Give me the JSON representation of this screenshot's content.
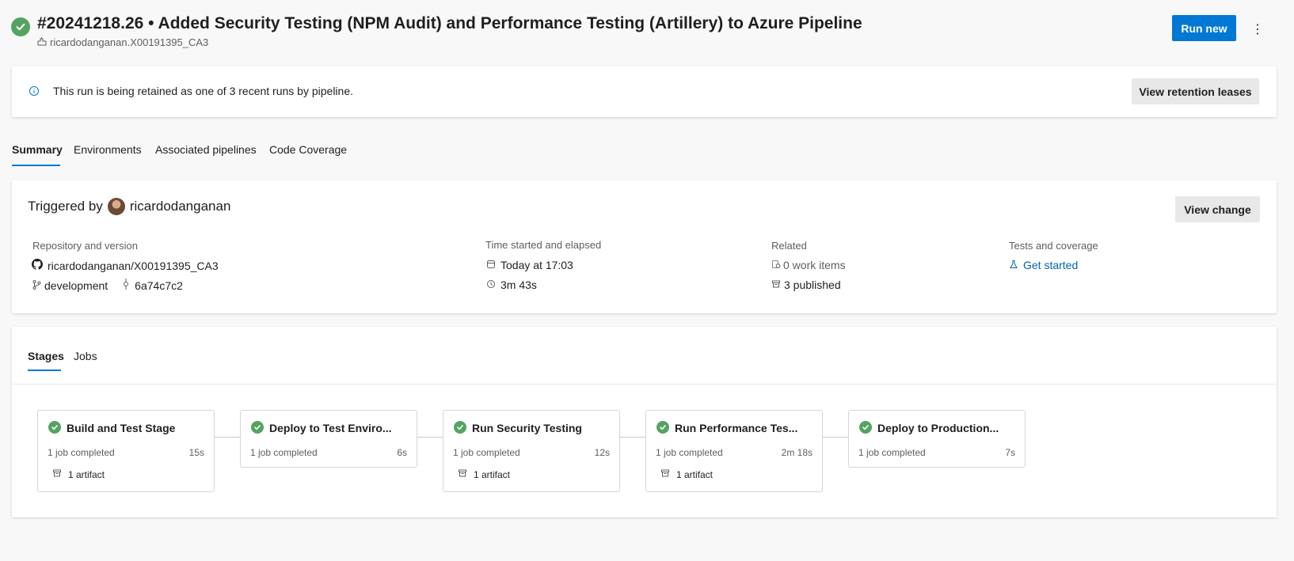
{
  "header": {
    "title": "#20241218.26 • Added Security Testing (NPM Audit) and Performance Testing (Artillery) to Azure Pipeline",
    "pipeline_name": "ricardodanganan.X00191395_CA3",
    "status_icon": "success-check-icon",
    "run_new_label": "Run new",
    "more_icon": "⋮"
  },
  "banner": {
    "text": "This run is being retained as one of 3 recent runs by pipeline.",
    "button_label": "View retention leases"
  },
  "tabs": [
    {
      "label": "Summary",
      "active": true
    },
    {
      "label": "Environments",
      "active": false
    },
    {
      "label": "Associated pipelines",
      "active": false
    },
    {
      "label": "Code Coverage",
      "active": false
    }
  ],
  "summary": {
    "triggered_prefix": "Triggered by",
    "triggered_user": "ricardodanganan",
    "view_change_label": "View change",
    "repo": {
      "label": "Repository and version",
      "repository": "ricardodanganan/X00191395_CA3",
      "branch": "development",
      "commit": "6a74c7c2"
    },
    "time": {
      "label": "Time started and elapsed",
      "started": "Today at 17:03",
      "elapsed": "3m 43s"
    },
    "related": {
      "label": "Related",
      "work_items": "0 work items",
      "published": "3 published"
    },
    "tests": {
      "label": "Tests and coverage",
      "link": "Get started"
    }
  },
  "stage_tabs": [
    {
      "label": "Stages",
      "active": true
    },
    {
      "label": "Jobs",
      "active": false
    }
  ],
  "stages": [
    {
      "name": "Build and Test Stage",
      "jobs": "1 job completed",
      "duration": "15s",
      "artifact": "1 artifact"
    },
    {
      "name": "Deploy to Test Enviro...",
      "jobs": "1 job completed",
      "duration": "6s",
      "artifact": null
    },
    {
      "name": "Run Security Testing",
      "jobs": "1 job completed",
      "duration": "12s",
      "artifact": "1 artifact"
    },
    {
      "name": "Run Performance Tes...",
      "jobs": "1 job completed",
      "duration": "2m 18s",
      "artifact": "1 artifact"
    },
    {
      "name": "Deploy to Production...",
      "jobs": "1 job completed",
      "duration": "7s",
      "artifact": null
    }
  ],
  "colors": {
    "success": "#55a362",
    "accent": "#0078d4",
    "link": "#0063b1"
  }
}
